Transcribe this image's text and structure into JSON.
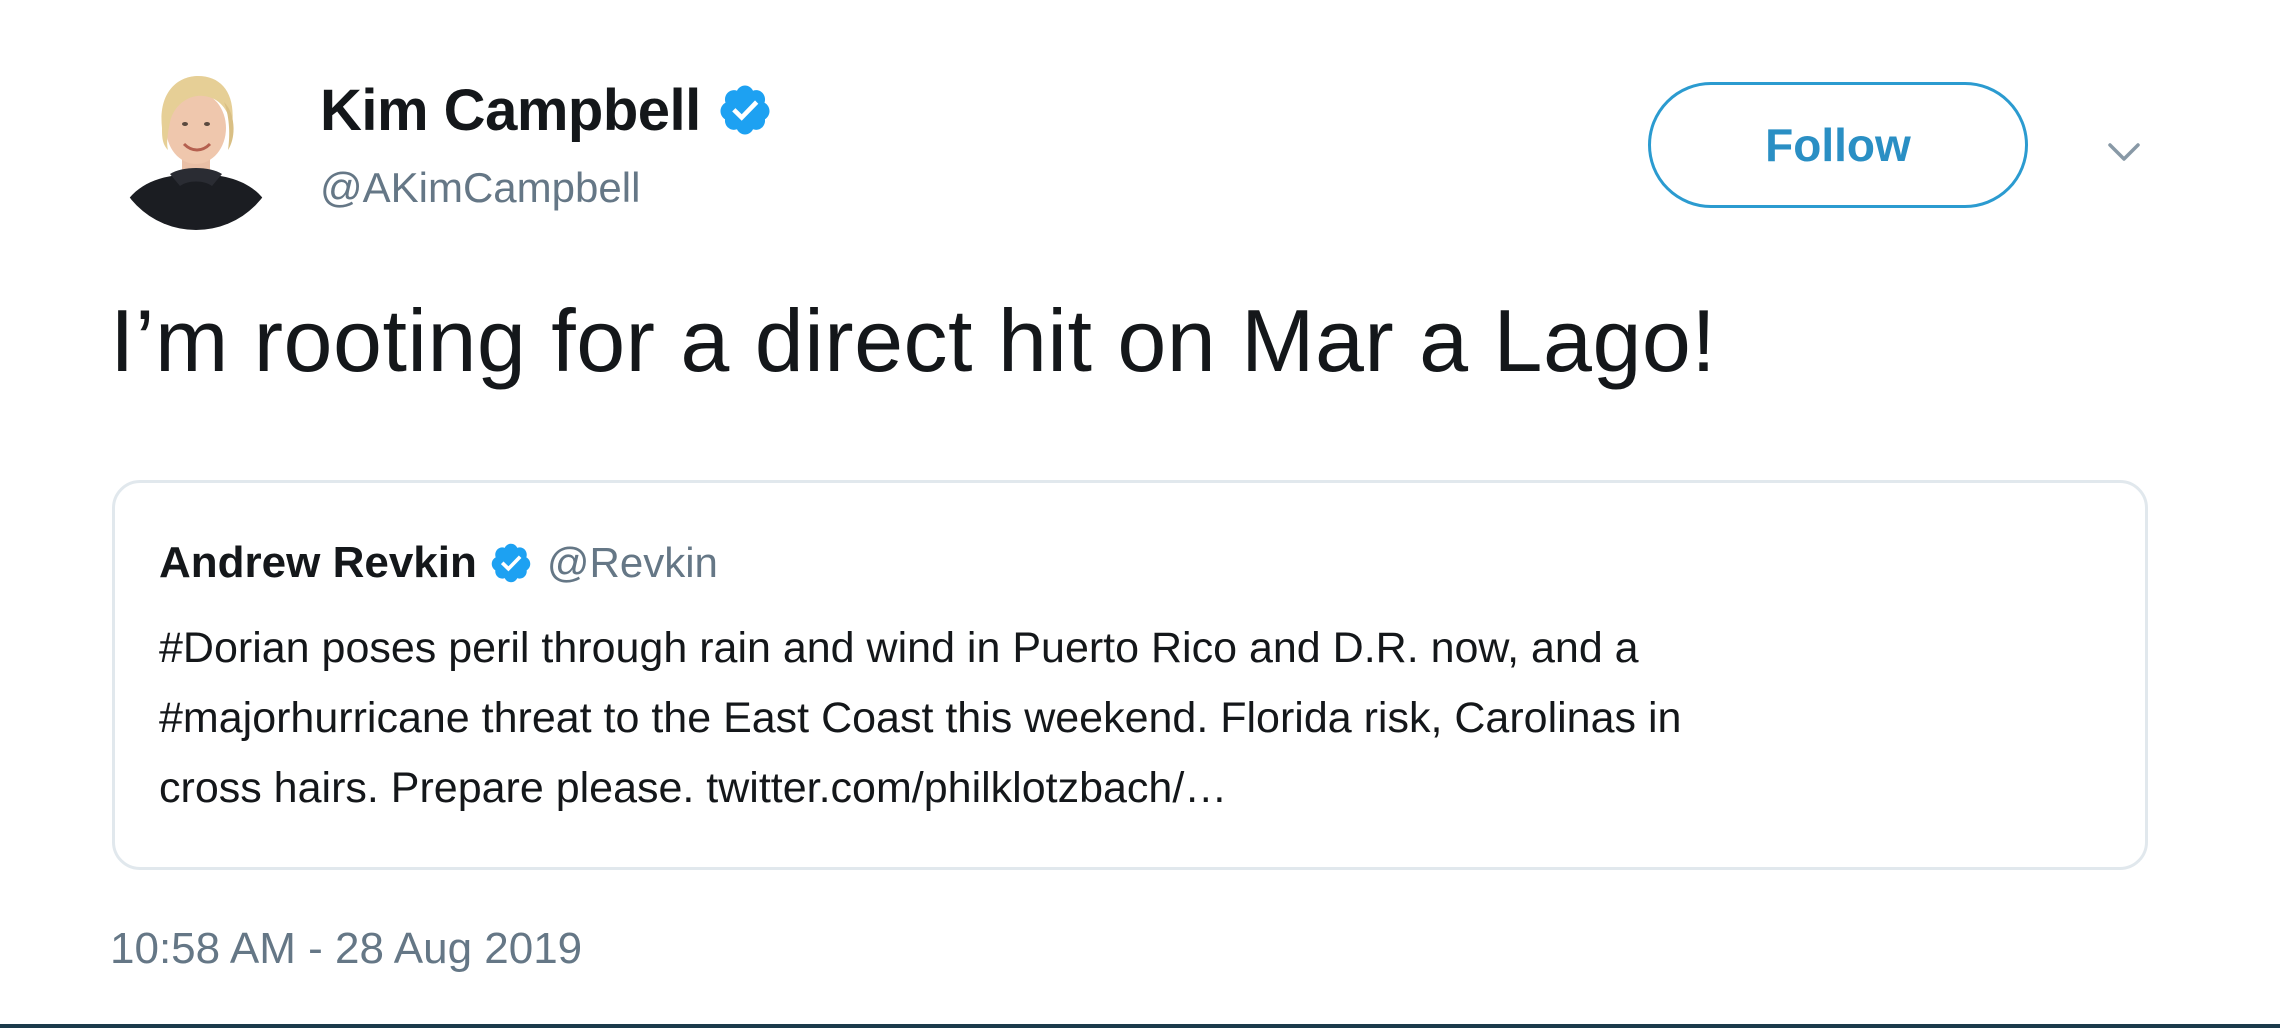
{
  "author": {
    "display_name": "Kim Campbell",
    "handle": "@AKimCampbell",
    "verified": true,
    "avatar_icon": "profile-photo"
  },
  "actions": {
    "follow_label": "Follow",
    "more_icon": "chevron-down-icon"
  },
  "tweet": {
    "text": "I’m rooting for a direct hit on Mar a Lago!",
    "timestamp": "10:58 AM - 28 Aug 2019"
  },
  "quoted_tweet": {
    "display_name": "Andrew Revkin",
    "handle": "@Revkin",
    "verified": true,
    "lines": [
      "#Dorian poses peril through rain and wind in Puerto Rico and D.R. now, and a",
      "#majorhurricane threat to the East Coast this weekend. Florida risk, Carolinas in",
      "cross hairs. Prepare please. twitter.com/philklotzbach/…"
    ]
  },
  "colors": {
    "accent": "#1DA1F2",
    "text_primary": "#14171A",
    "text_secondary": "#657786",
    "card_border": "#E1E8ED",
    "verified_badge": "#1DA1F2"
  }
}
